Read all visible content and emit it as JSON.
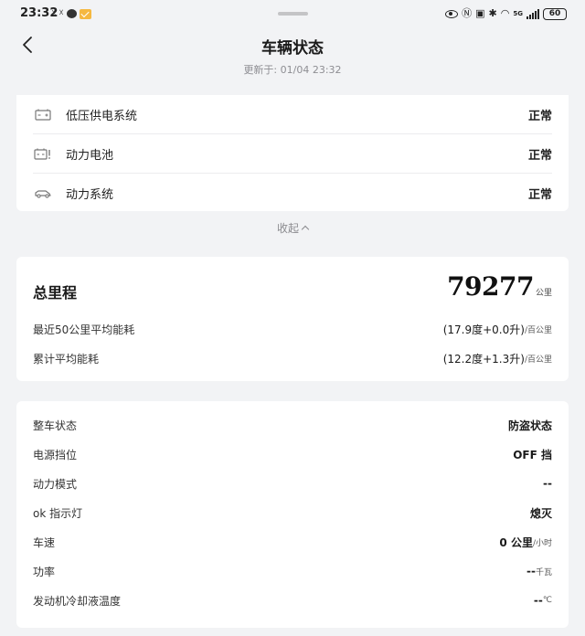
{
  "status_bar": {
    "time": "23:32",
    "network": "5G",
    "battery": "60"
  },
  "header": {
    "title": "车辆状态",
    "updated": "更新于: 01/04 23:32"
  },
  "system_status": [
    {
      "label": "低压供电系统",
      "value": "正常",
      "icon": "low-voltage-battery-icon"
    },
    {
      "label": "动力电池",
      "value": "正常",
      "icon": "power-battery-icon"
    },
    {
      "label": "动力系统",
      "value": "正常",
      "icon": "powertrain-icon"
    }
  ],
  "collapse_label": "收起",
  "mileage": {
    "label": "总里程",
    "value": "79277",
    "unit": "公里",
    "rows": [
      {
        "label": "最近50公里平均能耗",
        "value": "(17.9度+0.0升)",
        "unit": "/百公里"
      },
      {
        "label": "累计平均能耗",
        "value": "(12.2度+1.3升)",
        "unit": "/百公里"
      }
    ]
  },
  "details": [
    {
      "label": "整车状态",
      "value": "防盗状态",
      "unit": ""
    },
    {
      "label": "电源挡位",
      "value": "OFF 挡",
      "unit": ""
    },
    {
      "label": "动力模式",
      "value": "--",
      "unit": ""
    },
    {
      "label": "ok 指示灯",
      "value": "熄灭",
      "unit": ""
    },
    {
      "label": "车速",
      "value": "0 公里",
      "unit": "/小时"
    },
    {
      "label": "功率",
      "value": "--",
      "unit": "千瓦"
    },
    {
      "label": "发动机冷却液温度",
      "value": "--",
      "unit": "℃"
    }
  ]
}
